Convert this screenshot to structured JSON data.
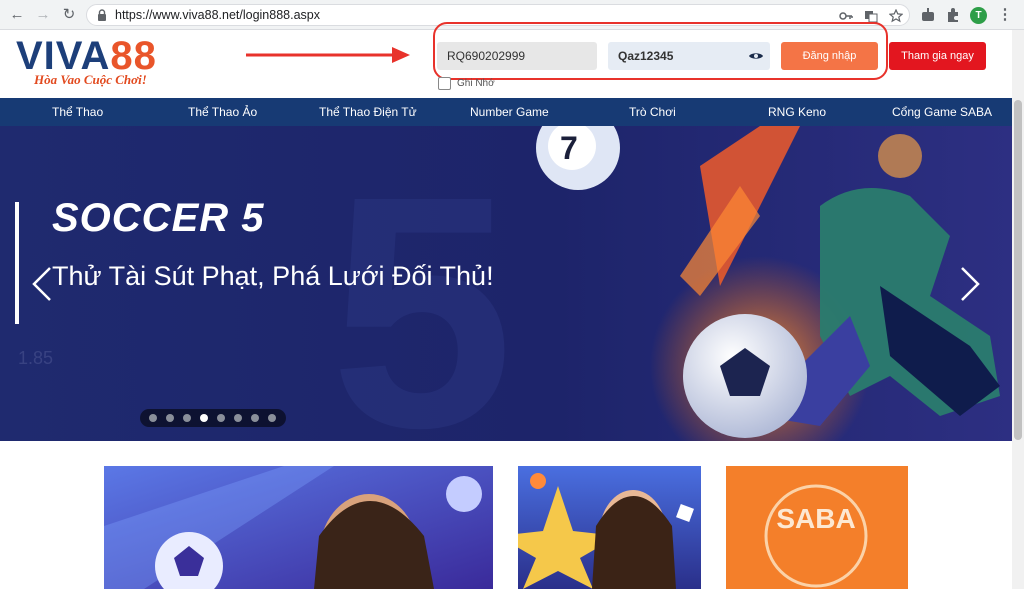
{
  "browser": {
    "url": "https://www.viva88.net/login888.aspx",
    "avatar_letter": "T"
  },
  "header": {
    "logo_viva": "VIVA",
    "logo_88": "88",
    "tagline": "Hòa Vao Cuộc Chơi!",
    "username_value": "RQ690202999",
    "password_value": "Qaz12345",
    "login_label": "Đăng nhập",
    "join_label": "Tham gia ngay",
    "remember_label": "Ghi Nhớ"
  },
  "menu": {
    "items": [
      "Thể Thao",
      "Thể Thao Ảo",
      "Thể Thao Điện Tử",
      "Number Game",
      "Trò Chơi",
      "RNG Keno",
      "Cổng Game SABA"
    ]
  },
  "banner": {
    "title": "SOCCER 5",
    "subtitle": "Thử Tài Sút Phạt, Phá Lưới Đối Thủ!",
    "ball_number": "7",
    "slide_count": 8,
    "active_slide": 4
  },
  "cards": {
    "saba_text": "SABA"
  },
  "colors": {
    "brand_navy": "#173a74",
    "login_orange": "#f47446",
    "join_red": "#e3161f",
    "highlight_red": "#e8322b"
  }
}
